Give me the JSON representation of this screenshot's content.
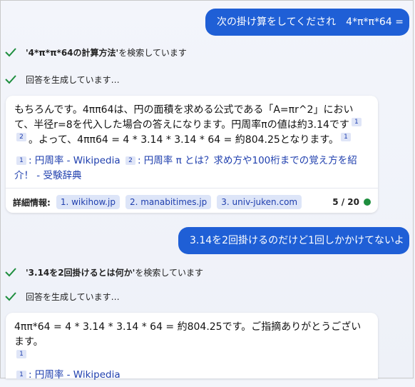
{
  "messages": {
    "user1": "次の掛け算をしてくだされ　4*π*π*64 =",
    "search1": {
      "query": "'4*π*π*64の計算方法'",
      "suffix": " を検索しています"
    },
    "generating1": "回答を生成しています…",
    "answer1": {
      "line1": "もちろんです。4ππ64は、円の面積を求める公式である「A=πr^2」におい",
      "line2": "て、半径r=8を代入した場合の答えになります。円周率πの値は約3.14です",
      "line3": "。よって、4ππ64 = 4 * 3.14 * 3.14 * 64 = 約804.25となります。",
      "cite1": "1",
      "cite2": "2",
      "cite3": "1",
      "ref1_num": "1",
      "ref1_text": ": 円周率 - Wikipedia",
      "ref2_num": "2",
      "ref2_text": ": 円周率 π とは？求め方や100桁までの覚え方を紹",
      "ref2_cont": "介！ - 受験辞典"
    },
    "learn_more": {
      "label": "詳細情報:",
      "chips": [
        "1. wikihow.jp",
        "2. manabitimes.jp",
        "3. univ-juken.com"
      ],
      "counter": "5 / 20"
    },
    "user2": "3.14を2回掛けるのだけど1回しかかけてないよ",
    "search2": {
      "query": "'3.14を2回掛けるとは何か'",
      "suffix": " を検索しています"
    },
    "generating2": "回答を生成しています…",
    "answer2": {
      "line1": "4ππ*64 = 4 * 3.14 * 3.14 * 64 = 約804.25です。ご指摘ありがとうございます。",
      "cite1": "1",
      "ref1_num": "1",
      "ref1_text": ": 円周率 - Wikipedia"
    }
  },
  "colors": {
    "user_bubble": "#1f5fd6",
    "check": "#1e8e3e",
    "link": "#1f3fae",
    "status_dot": "#1e8e3e"
  }
}
